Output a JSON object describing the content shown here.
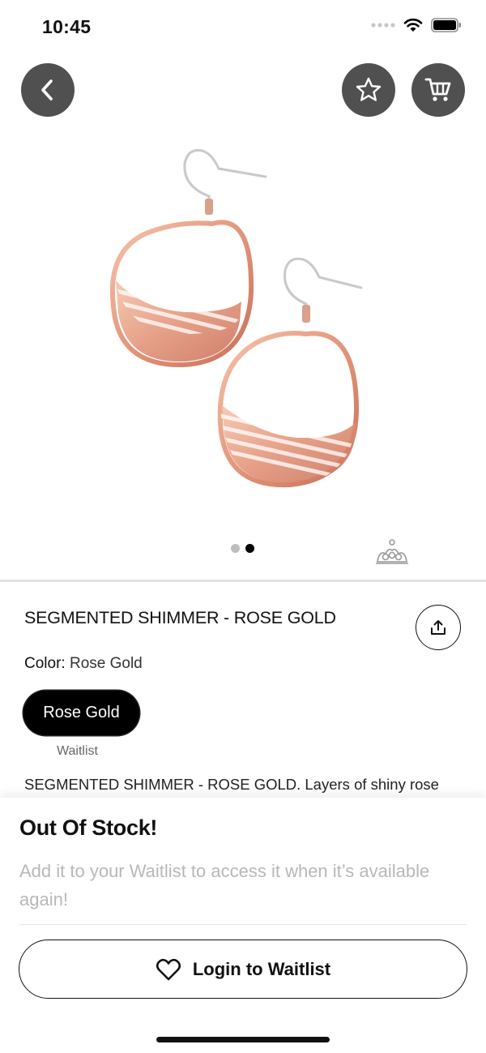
{
  "status_bar": {
    "time": "10:45"
  },
  "header": {
    "back_icon": "chevron-left-icon",
    "favorite_icon": "star-icon",
    "cart_icon": "cart-icon"
  },
  "gallery": {
    "image_count": 2,
    "active_index": 1
  },
  "product": {
    "title": "SEGMENTED SHIMMER - ROSE GOLD",
    "color_label": "Color:",
    "color_value": "Rose Gold",
    "variant_label": "Rose Gold",
    "variant_status": "Waitlist",
    "description": "SEGMENTED SHIMMER - ROSE GOLD. Layers of shiny rose"
  },
  "sheet": {
    "title": "Out Of Stock!",
    "message": "Add it to your Waitlist to access it when it’s available again!",
    "button_label": "Login to Waitlist"
  },
  "colors": {
    "circle_button": "#505050",
    "rose_gold": "#E59C7F",
    "muted_text": "#B8B8B8"
  }
}
